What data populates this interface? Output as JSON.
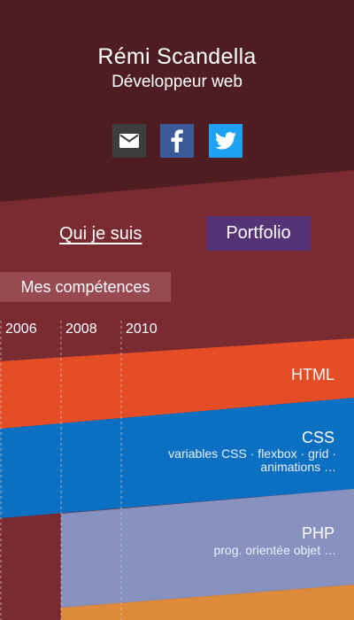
{
  "profile": {
    "name": "Rémi Scandella",
    "title": "Développeur web"
  },
  "social": [
    {
      "name": "email",
      "icon": "mail-icon",
      "color": "#3d3d3d"
    },
    {
      "name": "facebook",
      "icon": "facebook-icon",
      "color": "#3a5a98"
    },
    {
      "name": "twitter",
      "icon": "twitter-icon",
      "color": "#1da1f2"
    }
  ],
  "nav": {
    "about_label": "Qui je suis",
    "portfolio_label": "Portfolio"
  },
  "skills": {
    "title": "Mes compétences",
    "years": [
      "2006",
      "2008",
      "2010"
    ],
    "items": [
      {
        "name": "HTML",
        "details": "",
        "color": "#e44d26"
      },
      {
        "name": "CSS",
        "details_line1": "variables CSS · flexbox · grid ·",
        "details_line2": "animations …",
        "color": "#0b6fc2"
      },
      {
        "name": "PHP",
        "details": "prog. orientée objet …",
        "color": "#8892bf"
      }
    ]
  },
  "colors": {
    "header_bg": "#4d1d22",
    "main_bg": "#7a2a31",
    "accent_purple": "#553377",
    "next_band": "#dd8a3a"
  }
}
